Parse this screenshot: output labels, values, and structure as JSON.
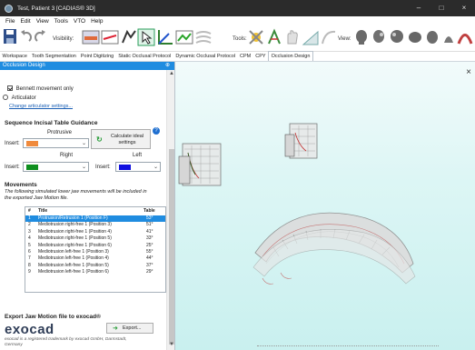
{
  "window": {
    "title": "Test, Patient 3 [CADIAS® 3D]",
    "minimize": "–",
    "maximize": "□",
    "close": "×"
  },
  "menu": [
    "File",
    "Edit",
    "View",
    "Tools",
    "VTO",
    "Help"
  ],
  "toolbar": {
    "visibility_label": "Visibility:",
    "tools_label": "Tools:",
    "view_label": "View:"
  },
  "tabs": [
    {
      "label": "Workspace",
      "active": false
    },
    {
      "label": "Tooth Segmentation",
      "active": false
    },
    {
      "label": "Point Digitizing",
      "active": false
    },
    {
      "label": "Static Occlusal Protocol",
      "active": false
    },
    {
      "label": "Dynamic Occlusal Protocol",
      "active": false
    },
    {
      "label": "CPM",
      "active": false
    },
    {
      "label": "CPY",
      "active": false
    },
    {
      "label": "Occlusion Design",
      "active": true
    }
  ],
  "panel": {
    "title": "Occlusion Design",
    "pin": "⊕",
    "scroll_up": "▲",
    "scroll_down": "▼",
    "bennett_label": "Bennett movement only",
    "articulator_label": "Articulator",
    "change_settings_link": "Change articulator settings...",
    "sequence_heading": "Sequence Incisal Table Guidance",
    "protrusive_label": "Protrusive",
    "insert_label": "Insert:",
    "calc_button": "Calculate ideal settings",
    "help_icon": "?",
    "right_label": "Right",
    "left_label": "Left",
    "combo_arrow": "⌄",
    "protrusive_color": "#f08a3c",
    "right_color": "#0f8f1f",
    "left_color": "#1010e0",
    "movements_heading": "Movements",
    "movements_desc": "The following simulated lower jaw movements will be included in the exported Jaw Motion file.",
    "export_heading": "Export Jaw Motion file to exocad®",
    "exocad_logo": "exocad",
    "export_button": "Export...",
    "trademark_note": "exocad is a registered trademark by exocad GmbH, Darmstadt, Germany"
  },
  "movements_table": {
    "columns": [
      "#",
      "Title",
      "Table"
    ],
    "rows": [
      {
        "num": "1",
        "title": "Protrusion/Retrusion 1 (Position F)",
        "table": "53°",
        "selected": true
      },
      {
        "num": "2",
        "title": "Mediotrusion right-free 1 (Position 3)",
        "table": "51°",
        "selected": false
      },
      {
        "num": "3",
        "title": "Mediotrusion right-free 1 (Position 4)",
        "table": "41°",
        "selected": false
      },
      {
        "num": "4",
        "title": "Mediotrusion right-free 1 (Position 5)",
        "table": "33°",
        "selected": false
      },
      {
        "num": "5",
        "title": "Mediotrusion right-free 1 (Position 6)",
        "table": "25°",
        "selected": false
      },
      {
        "num": "6",
        "title": "Mediotrusion left-free 1 (Position 3)",
        "table": "55°",
        "selected": false
      },
      {
        "num": "7",
        "title": "Mediotrusion left-free 1 (Position 4)",
        "table": "44°",
        "selected": false
      },
      {
        "num": "8",
        "title": "Mediotrusion left-free 1 (Position 5)",
        "table": "37°",
        "selected": false
      },
      {
        "num": "9",
        "title": "Mediotrusion left-free 1 (Position 6)",
        "table": "29°",
        "selected": false
      }
    ]
  },
  "viewport": {
    "close_icon": "×"
  }
}
